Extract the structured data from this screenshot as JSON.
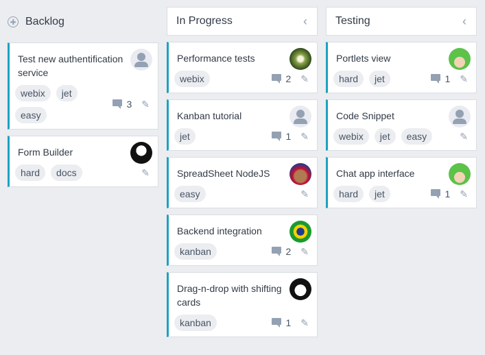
{
  "columns": [
    {
      "title": "Backlog",
      "header_icon": "add-icon",
      "cards": [
        {
          "title": "Test new authentification service",
          "avatar": "placeholder-user",
          "tags": [
            "webix",
            "jet",
            "easy"
          ],
          "comments": "3"
        },
        {
          "title": "Form Builder",
          "avatar": "photo-sunglasses-man",
          "tags": [
            "hard",
            "docs"
          ],
          "comments": null
        }
      ]
    },
    {
      "title": "In Progress",
      "header_icon": "chevron-left-icon",
      "collapse_glyph": "‹",
      "cards": [
        {
          "title": "Performance tests",
          "avatar": "photo-flower",
          "tags": [
            "webix"
          ],
          "comments": "2"
        },
        {
          "title": "Kanban tutorial",
          "avatar": "placeholder-user",
          "tags": [
            "jet"
          ],
          "comments": "1"
        },
        {
          "title": "SpreadSheet NodeJS",
          "avatar": "photo-bulldog",
          "tags": [
            "easy"
          ],
          "comments": null
        },
        {
          "title": "Backend integration",
          "avatar": "photo-brazil-flag",
          "tags": [
            "kanban"
          ],
          "comments": "2"
        },
        {
          "title": "Drag-n-drop with shifting cards",
          "avatar": "photo-penguin",
          "tags": [
            "kanban"
          ],
          "comments": "1"
        }
      ]
    },
    {
      "title": "Testing",
      "header_icon": "chevron-left-icon",
      "collapse_glyph": "‹",
      "cards": [
        {
          "title": "Portlets view",
          "avatar": "photo-anime-green-hair",
          "tags": [
            "hard",
            "jet"
          ],
          "comments": "1"
        },
        {
          "title": "Code Snippet",
          "avatar": "placeholder-user",
          "tags": [
            "webix",
            "jet",
            "easy"
          ],
          "comments": null
        },
        {
          "title": "Chat app interface",
          "avatar": "photo-anime-green-hair",
          "tags": [
            "hard",
            "jet"
          ],
          "comments": "1"
        }
      ]
    }
  ],
  "icons": {
    "edit": "✎"
  },
  "colors": {
    "accent": "#1ca1c1",
    "background": "#ebedf0",
    "icon": "#94a1b3"
  }
}
